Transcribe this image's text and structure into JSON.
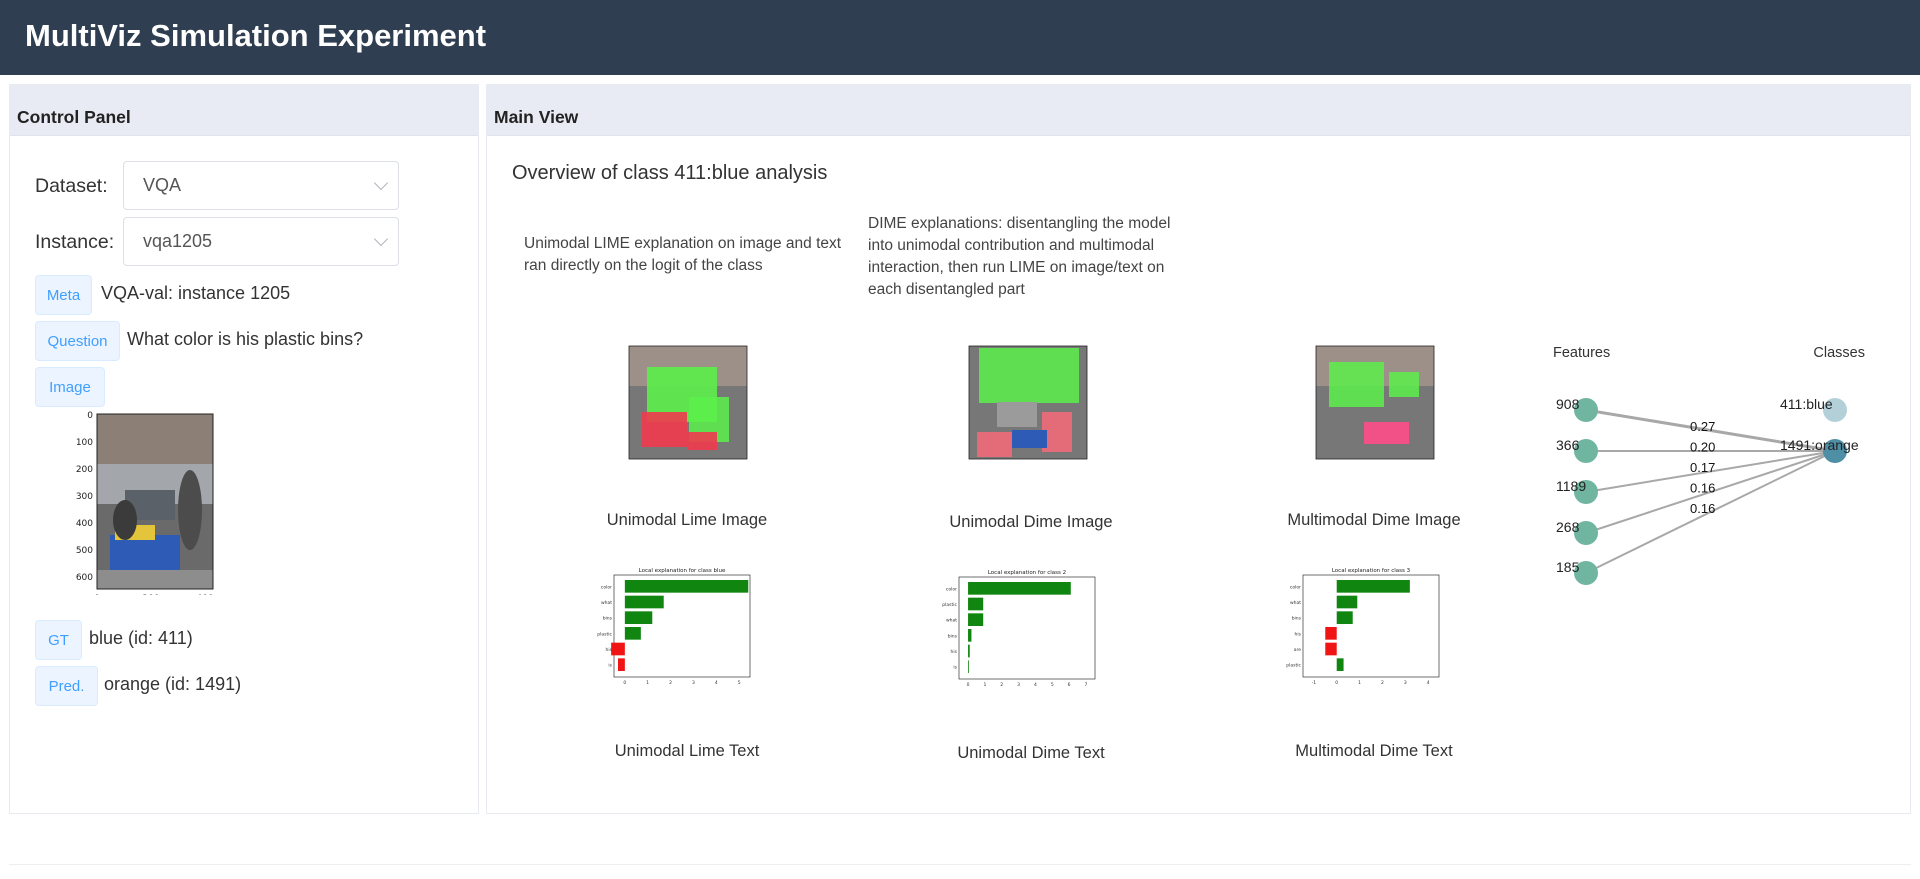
{
  "app": {
    "title": "MultiViz Simulation Experiment"
  },
  "control_panel": {
    "heading": "Control Panel",
    "dataset": {
      "label": "Dataset:",
      "value": "VQA"
    },
    "instance": {
      "label": "Instance:",
      "value": "vqa1205"
    },
    "meta": {
      "tag": "Meta",
      "value": "VQA-val: instance 1205"
    },
    "question": {
      "tag": "Question",
      "value": "What color is his plastic bins?"
    },
    "image": {
      "tag": "Image",
      "y_ticks": [
        "0",
        "100",
        "200",
        "300",
        "400",
        "500",
        "600"
      ],
      "x_ticks": [
        "0",
        "200",
        "400"
      ]
    },
    "gt": {
      "tag": "GT",
      "value": "blue (id: 411)"
    },
    "pred": {
      "tag": "Pred.",
      "value": "orange (id: 1491)"
    }
  },
  "main_view": {
    "heading": "Main View",
    "overview_title": "Overview of class 411:blue analysis",
    "lime_description": "Unimodal LIME explanation on image and text ran directly on the logit of the class",
    "dime_description": "DIME explanations: disentangling the model into unimodal contribution and multimodal interaction, then run LIME on image/text on each disentangled part",
    "captions": {
      "unimodal_lime_image": "Unimodal Lime Image",
      "unimodal_dime_image": "Unimodal Dime Image",
      "multimodal_dime_image": "Multimodal Dime Image",
      "unimodal_lime_text": "Unimodal Lime Text",
      "unimodal_dime_text": "Unimodal Dime Text",
      "multimodal_dime_text": "Multimodal Dime Text"
    },
    "text_charts": {
      "unimodal_lime_text": {
        "title": "Local explanation for class blue",
        "words": [
          "color",
          "what",
          "bins",
          "plastic",
          "his",
          "is"
        ],
        "values": [
          5.4,
          1.7,
          1.2,
          0.7,
          -0.6,
          -0.3
        ],
        "xticks": [
          "0",
          "1",
          "2",
          "3",
          "4",
          "5"
        ]
      },
      "unimodal_dime_text": {
        "title": "Local explanation for class 2",
        "words": [
          "color",
          "plastic",
          "what",
          "bins",
          "his",
          "is"
        ],
        "values": [
          6.1,
          0.9,
          0.9,
          0.2,
          0.1,
          0.0
        ],
        "xticks": [
          "0",
          "1",
          "2",
          "3",
          "4",
          "5",
          "6",
          "7"
        ]
      },
      "multimodal_dime_text": {
        "title": "Local explanation for class 3",
        "words": [
          "color",
          "what",
          "bins",
          "his",
          "are",
          "plastic"
        ],
        "values": [
          3.2,
          0.9,
          0.7,
          -0.5,
          -0.5,
          0.3
        ],
        "xticks": [
          "-1",
          "0",
          "1",
          "2",
          "3",
          "4"
        ]
      }
    },
    "graph": {
      "features_label": "Features",
      "classes_label": "Classes",
      "features": [
        "908",
        "366",
        "1189",
        "268",
        "185"
      ],
      "classes": [
        "411:blue",
        "1491:orange"
      ],
      "edge_weights": [
        "0.27",
        "0.20",
        "0.17",
        "0.16",
        "0.16"
      ],
      "colors": {
        "feature": "#6fb5a0",
        "class_blue": "#b3d0d9",
        "class_orange": "#4f8fa6",
        "edge": "#a8a8a8"
      }
    }
  }
}
